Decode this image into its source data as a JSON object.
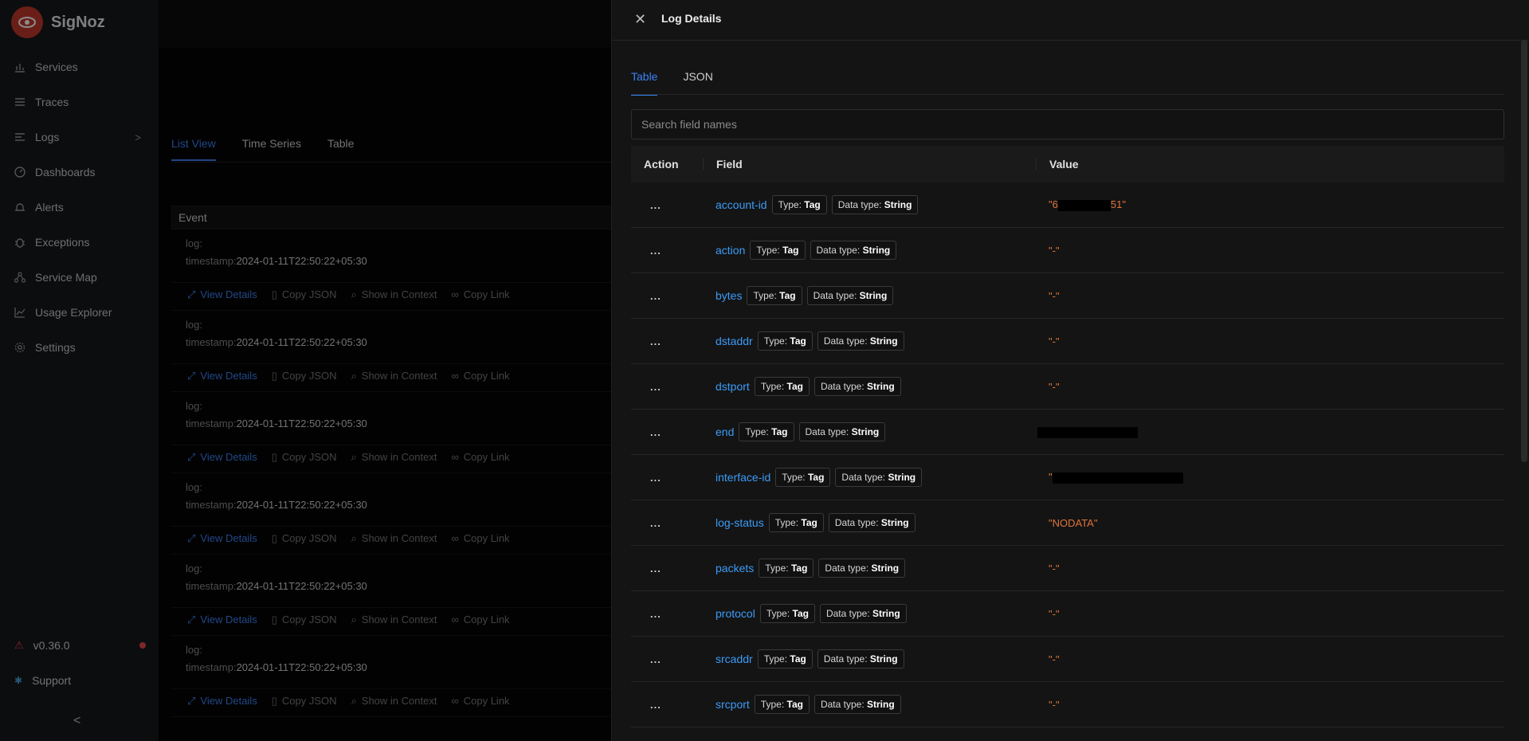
{
  "brand": {
    "name": "SigNoz"
  },
  "sidebar": {
    "items": [
      {
        "label": "Services",
        "icon": "bar-chart-icon"
      },
      {
        "label": "Traces",
        "icon": "list-icon"
      },
      {
        "label": "Logs",
        "icon": "logs-icon",
        "chevron": ">"
      },
      {
        "label": "Dashboards",
        "icon": "dashboard-icon"
      },
      {
        "label": "Alerts",
        "icon": "alarm-icon"
      },
      {
        "label": "Exceptions",
        "icon": "bug-icon"
      },
      {
        "label": "Service Map",
        "icon": "network-icon"
      },
      {
        "label": "Usage Explorer",
        "icon": "line-chart-icon"
      },
      {
        "label": "Settings",
        "icon": "gear-icon"
      }
    ],
    "version": "v0.36.0",
    "support": "Support",
    "collapse": "<"
  },
  "main": {
    "tabs": [
      "List View",
      "Time Series",
      "Table"
    ],
    "event_header": "Event",
    "events": [
      {
        "log": "log:",
        "timestamp_label": "timestamp:",
        "timestamp": "2024-01-11T22:50:22+05:30"
      },
      {
        "log": "log:",
        "timestamp_label": "timestamp:",
        "timestamp": "2024-01-11T22:50:22+05:30"
      },
      {
        "log": "log:",
        "timestamp_label": "timestamp:",
        "timestamp": "2024-01-11T22:50:22+05:30"
      },
      {
        "log": "log:",
        "timestamp_label": "timestamp:",
        "timestamp": "2024-01-11T22:50:22+05:30"
      },
      {
        "log": "log:",
        "timestamp_label": "timestamp:",
        "timestamp": "2024-01-11T22:50:22+05:30"
      },
      {
        "log": "log:",
        "timestamp_label": "timestamp:",
        "timestamp": "2024-01-11T22:50:22+05:30"
      }
    ],
    "actions": {
      "view": "View Details",
      "copy_json": "Copy JSON",
      "context": "Show in Context",
      "copy_link": "Copy Link"
    }
  },
  "drawer": {
    "title": "Log Details",
    "tabs": [
      "Table",
      "JSON"
    ],
    "search_placeholder": "Search field names",
    "columns": {
      "action": "Action",
      "field": "Field",
      "value": "Value"
    },
    "type_label": "Type:",
    "type_value": "Tag",
    "datatype_label": "Data type:",
    "datatype_value": "String",
    "rows": [
      {
        "action": "...",
        "field": "account-id",
        "value": "\"6",
        "value_tail": "51\"",
        "redacted": true
      },
      {
        "action": "...",
        "field": "action",
        "value": "\"-\""
      },
      {
        "action": "...",
        "field": "bytes",
        "value": "\"-\""
      },
      {
        "action": "...",
        "field": "dstaddr",
        "value": "\"-\""
      },
      {
        "action": "...",
        "field": "dstport",
        "value": "\"-\""
      },
      {
        "action": "...",
        "field": "end",
        "value": "",
        "redacted": true
      },
      {
        "action": "...",
        "field": "interface-id",
        "value": "\"",
        "redacted": true
      },
      {
        "action": "...",
        "field": "log-status",
        "value": "\"NODATA\""
      },
      {
        "action": "...",
        "field": "packets",
        "value": "\"-\""
      },
      {
        "action": "...",
        "field": "protocol",
        "value": "\"-\""
      },
      {
        "action": "...",
        "field": "srcaddr",
        "value": "\"-\""
      },
      {
        "action": "...",
        "field": "srcport",
        "value": "\"-\""
      }
    ]
  },
  "colors": {
    "accent": "#3b82f6",
    "field": "#3b9bf6",
    "value": "#e0733a",
    "brand": "#c0392b"
  }
}
